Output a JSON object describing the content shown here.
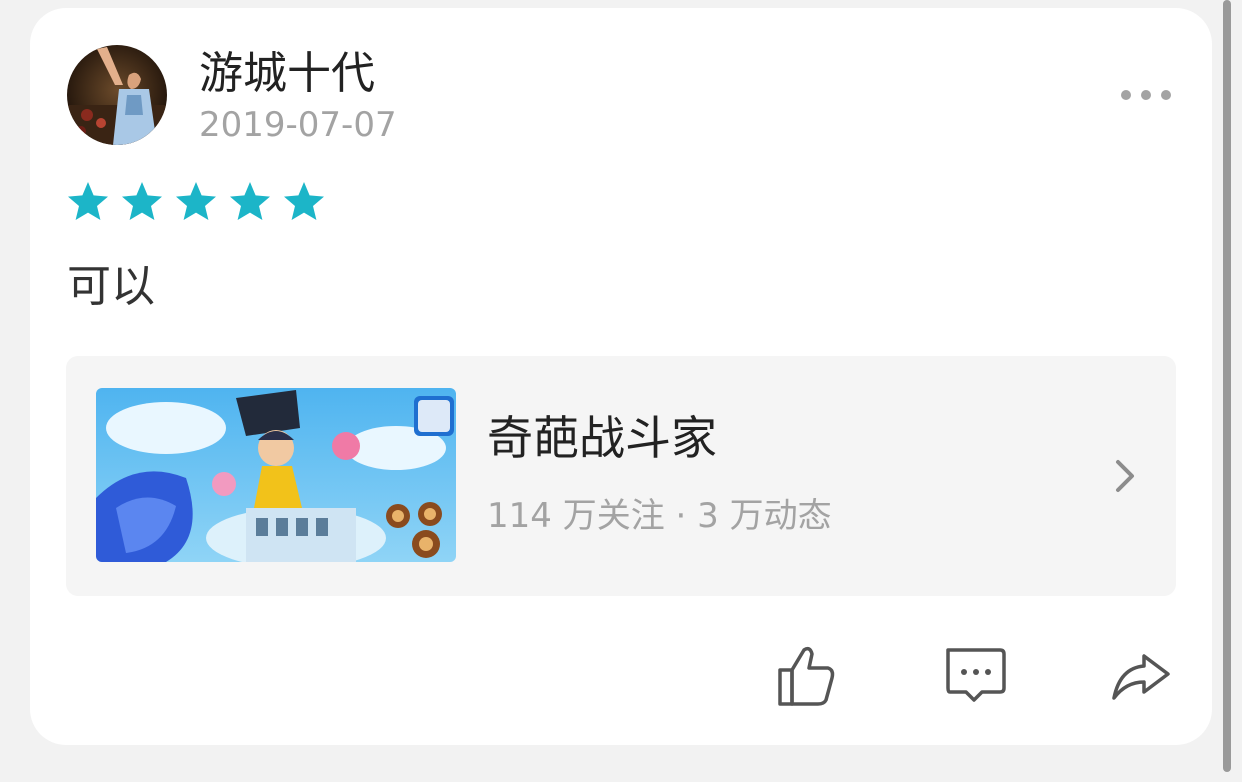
{
  "post": {
    "username": "游城十代",
    "date": "2019-07-07",
    "rating": 5,
    "comment": "可以"
  },
  "game": {
    "title": "奇葩战斗家",
    "stats": "114 万关注 · 3 万动态"
  },
  "icons": {
    "more": "more-dots-icon",
    "star": "star-icon",
    "chevron": "chevron-right-icon",
    "like": "thumbs-up-icon",
    "comment": "comment-bubble-icon",
    "share": "share-arrow-icon"
  },
  "colors": {
    "star": "#1cb5c8",
    "icon": "#555555",
    "muted": "#a3a3a3"
  }
}
